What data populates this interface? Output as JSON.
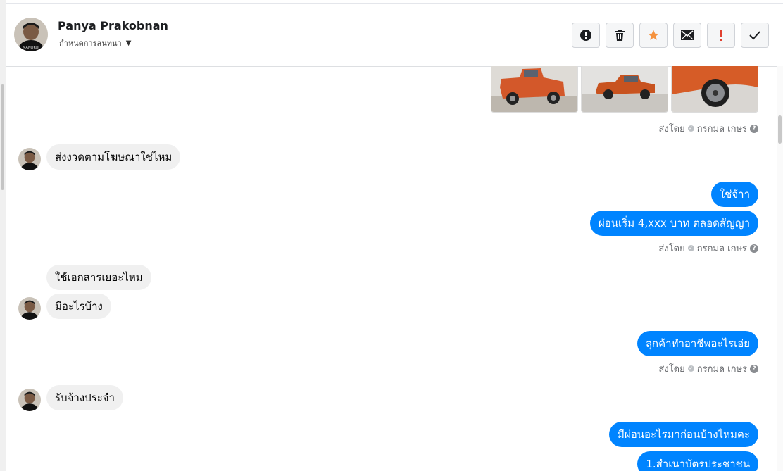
{
  "header": {
    "name": "Panya Prakobnan",
    "subtitle": "กำหนดการสนทนา",
    "actions": [
      {
        "icon": "alert-circle-icon"
      },
      {
        "icon": "trash-icon"
      },
      {
        "icon": "star-icon",
        "color": "#f5923e"
      },
      {
        "icon": "mail-icon"
      },
      {
        "icon": "exclamation-icon",
        "color": "#e0402f"
      },
      {
        "icon": "checkmark-icon"
      }
    ]
  },
  "colors": {
    "outgoing": "#0084ff",
    "incoming": "#f0f0f0"
  },
  "messages": {
    "sent_by_label": "ส่งโดย",
    "sender_name": "กรกมล เกษร",
    "m1": "ส่งงวดตามโฆษณาใช่ไหม",
    "m2": "ใช่จ้าา",
    "m3": "ผ่อนเริ่ม 4,xxx บาท ตลอดสัญญา",
    "m4": "ใช้เอกสารเยอะไหม",
    "m5": "มีอะไรบ้าง",
    "m6": "ลุกค้าทำอาชีพอะไรเอ่ย",
    "m7": "รับจ้างประจำ",
    "m8": "มีผ่อนอะไรมาก่อนบ้างไหมคะ",
    "m9": "1.สำเนาบัตรประชาชน"
  }
}
